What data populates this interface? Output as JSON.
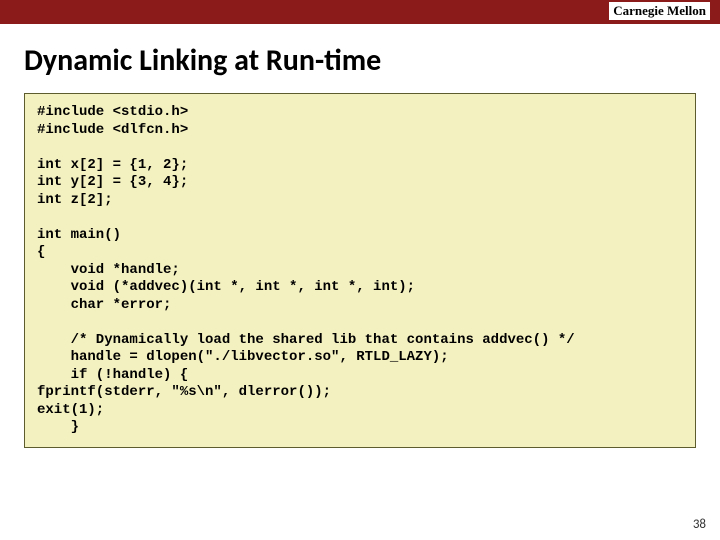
{
  "header": {
    "logo": "Carnegie Mellon"
  },
  "title": "Dynamic Linking at Run-time",
  "code": "#include <stdio.h>\n#include <dlfcn.h>\n\nint x[2] = {1, 2};\nint y[2] = {3, 4};\nint z[2];\n\nint main()\n{\n    void *handle;\n    void (*addvec)(int *, int *, int *, int);\n    char *error;\n\n    /* Dynamically load the shared lib that contains addvec() */\n    handle = dlopen(\"./libvector.so\", RTLD_LAZY);\n    if (!handle) {\nfprintf(stderr, \"%s\\n\", dlerror());\nexit(1);\n    }",
  "page_number": "38"
}
